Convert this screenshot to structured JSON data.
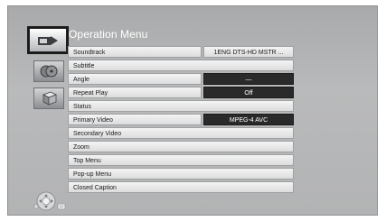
{
  "menu_title": "Operation Menu",
  "tabs": [
    {
      "icon": "playback-icon",
      "active": true
    },
    {
      "icon": "disc-icon",
      "active": false
    },
    {
      "icon": "box-icon",
      "active": false
    }
  ],
  "items": [
    {
      "label": "Soundtrack",
      "value": "1ENG DTS-HD MSTR ..."
    },
    {
      "label": "Subtitle"
    },
    {
      "label": "Angle",
      "value": "—"
    },
    {
      "label": "Repeat Play",
      "value": "Off"
    },
    {
      "label": "Status"
    },
    {
      "label": "Primary Video",
      "value": "MPEG-4 AVC"
    },
    {
      "label": "Secondary Video"
    },
    {
      "label": "Zoom"
    },
    {
      "label": "Top Menu"
    },
    {
      "label": "Pop-up Menu"
    },
    {
      "label": "Closed Caption"
    }
  ],
  "colors": {
    "background": "#b3b4b5",
    "item": "#e8e8e8",
    "value_dark": "#2a2a2a"
  },
  "nav_hint_icon": "remote-navigation-icon"
}
